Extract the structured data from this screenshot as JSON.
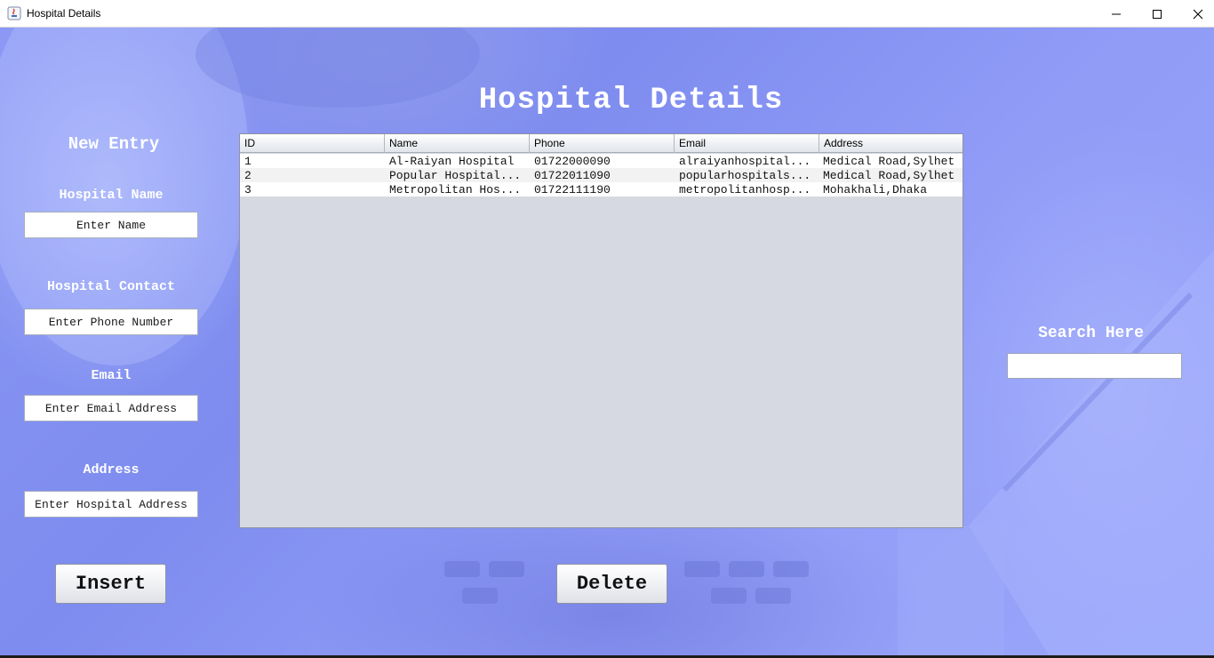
{
  "window": {
    "title": "Hospital Details",
    "icon": "java-icon",
    "controls": [
      "minimize-icon",
      "maximize-icon",
      "close-icon"
    ]
  },
  "heading": "Hospital Details",
  "form": {
    "title": "New Entry",
    "name_label": "Hospital Name",
    "name_placeholder": "Enter Name",
    "contact_label": "Hospital Contact",
    "contact_placeholder": "Enter Phone Number",
    "email_label": "Email",
    "email_placeholder": "Enter Email Address",
    "address_label": "Address",
    "address_placeholder": "Enter Hospital Address"
  },
  "table": {
    "columns": [
      "ID",
      "Name",
      "Phone",
      "Email",
      "Address"
    ],
    "rows": [
      [
        "1",
        "Al-Raiyan Hospital",
        "01722000090",
        "alraiyanhospital...",
        "Medical Road,Sylhet"
      ],
      [
        "2",
        "Popular Hospital...",
        "01722011090",
        "popularhospitals...",
        "Medical Road,Sylhet"
      ],
      [
        "3",
        "Metropolitan Hos...",
        "01722111190",
        "metropolitanhosp...",
        "Mohakhali,Dhaka"
      ]
    ]
  },
  "search": {
    "label": "Search Here",
    "value": ""
  },
  "buttons": {
    "insert": "Insert",
    "delete": "Delete"
  }
}
